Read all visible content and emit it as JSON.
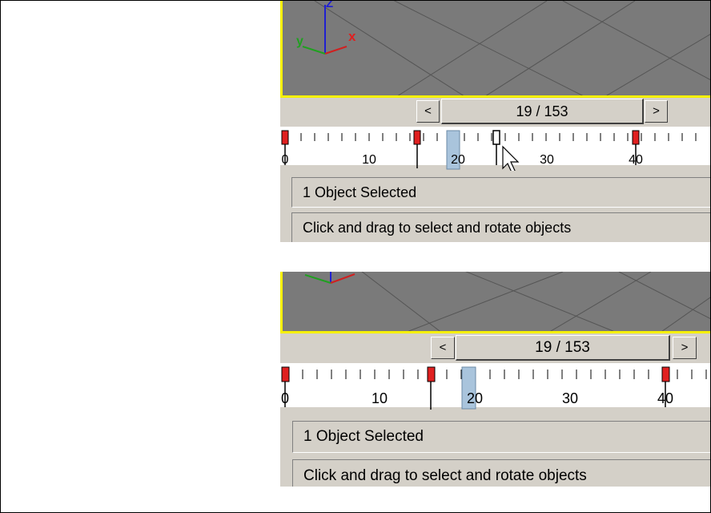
{
  "top": {
    "prev_label": "<",
    "next_label": ">",
    "frame_readout": "19 / 153",
    "ticks": [
      "0",
      "10",
      "20",
      "30",
      "40"
    ],
    "status_selection": "1 Object Selected",
    "status_prompt": "Click and drag to select and rotate objects"
  },
  "bottom": {
    "prev_label": "<",
    "next_label": ">",
    "frame_readout": "19 / 153",
    "ticks": [
      "0",
      "10",
      "20",
      "30",
      "40"
    ],
    "status_selection": "1 Object Selected",
    "status_prompt": "Click and drag to select and rotate objects"
  },
  "colors": {
    "viewport_bg": "#7a7a7a",
    "viewport_border": "#f5f000",
    "key_red": "#e02020",
    "slider_marker": "#a9c4dc"
  },
  "icons": {
    "axis_gizmo": "axis-tripod-icon",
    "pointer": "arrow-cursor-icon"
  }
}
